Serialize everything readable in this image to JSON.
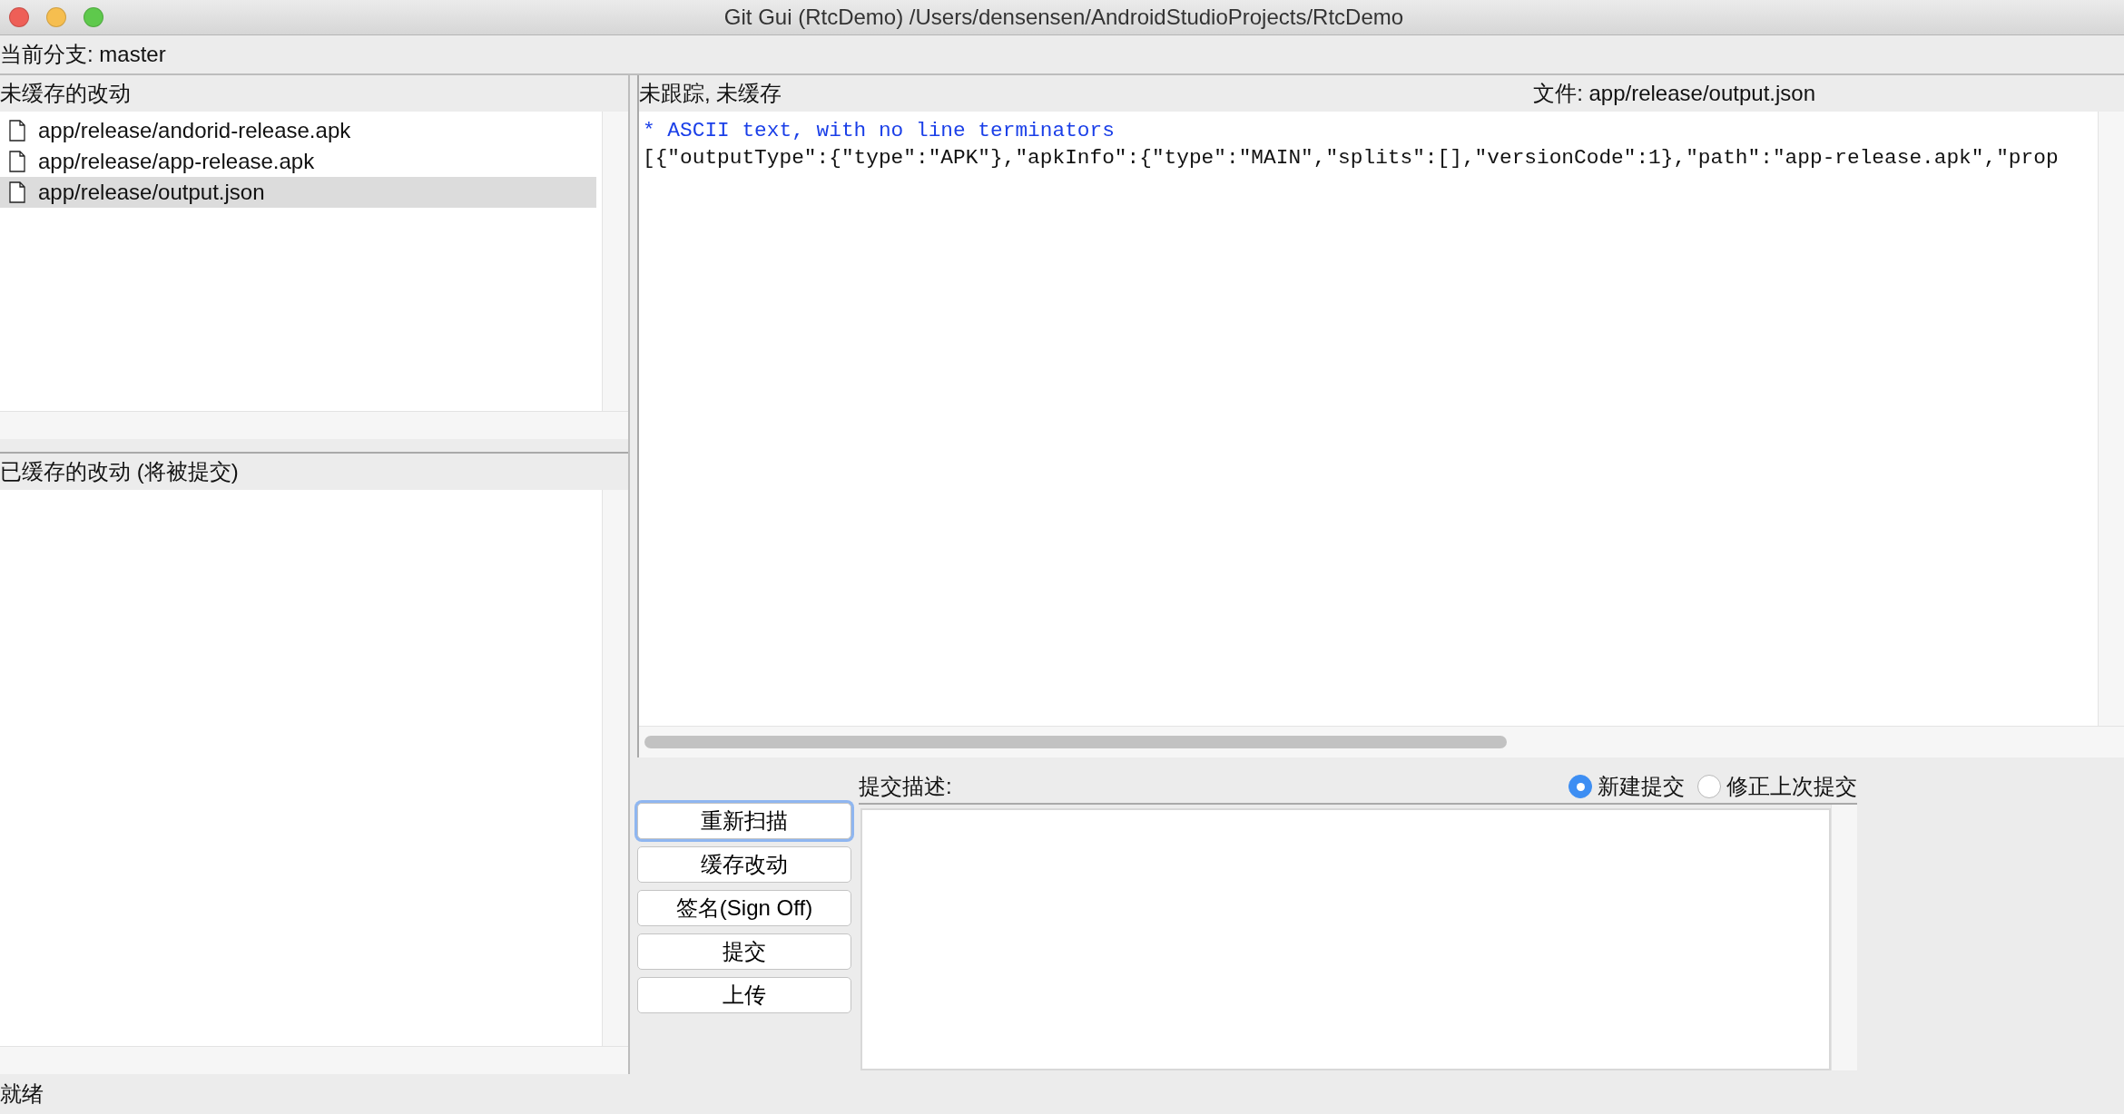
{
  "window": {
    "title": "Git Gui (RtcDemo) /Users/densensen/AndroidStudioProjects/RtcDemo"
  },
  "branch": {
    "label": "当前分支: master"
  },
  "unstaged": {
    "title": "未缓存的改动",
    "files": [
      {
        "name": "app/release/andorid-release.apk",
        "selected": false
      },
      {
        "name": "app/release/app-release.apk",
        "selected": false
      },
      {
        "name": "app/release/output.json",
        "selected": true
      }
    ]
  },
  "staged": {
    "title": "已缓存的改动 (将被提交)"
  },
  "diff": {
    "status": "未跟踪, 未缓存",
    "file": "文件: app/release/output.json",
    "lines": [
      {
        "kind": "info",
        "text": "* ASCII text, with no line terminators"
      },
      {
        "kind": "plain",
        "text": "[{\"outputType\":{\"type\":\"APK\"},\"apkInfo\":{\"type\":\"MAIN\",\"splits\":[],\"versionCode\":1},\"path\":\"app-release.apk\",\"prop"
      }
    ]
  },
  "buttons": [
    {
      "label": "重新扫描",
      "focused": true
    },
    {
      "label": "缓存改动",
      "focused": false
    },
    {
      "label": "签名(Sign Off)",
      "focused": false
    },
    {
      "label": "提交",
      "focused": false
    },
    {
      "label": "上传",
      "focused": false
    }
  ],
  "commit": {
    "label": "提交描述:",
    "modes": [
      {
        "label": "新建提交",
        "selected": true
      },
      {
        "label": "修正上次提交",
        "selected": false
      }
    ]
  },
  "status_bar": {
    "text": "就绪"
  }
}
